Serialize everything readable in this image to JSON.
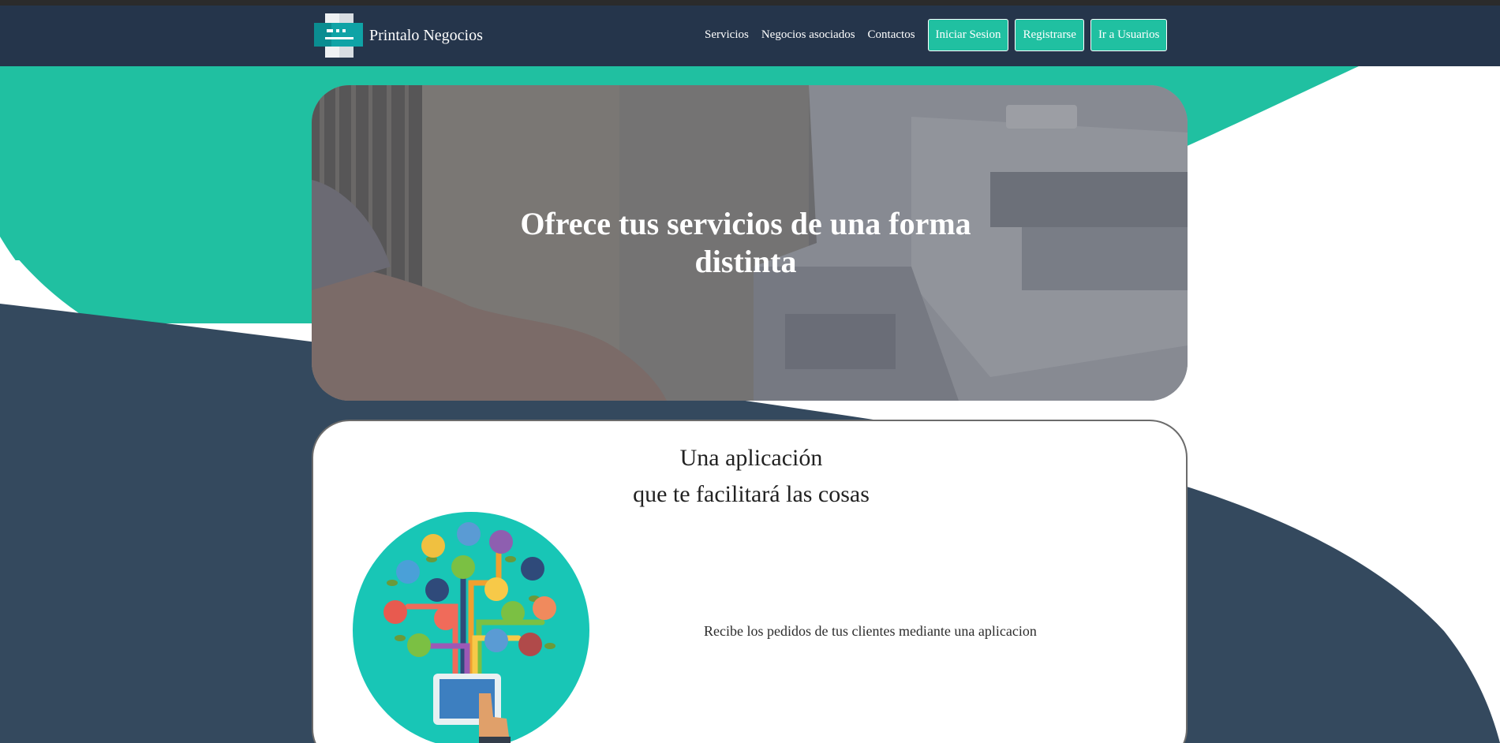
{
  "brand": {
    "name": "Printalo Negocios",
    "logo_icon": "printer-logo-icon"
  },
  "nav": {
    "links": [
      "Servicios",
      "Negocios asociados",
      "Contactos"
    ],
    "buttons": [
      "Iniciar Sesion",
      "Registrarse",
      "Ir a Usuarios"
    ]
  },
  "hero": {
    "title": "Ofrece tus servicios de una forma distinta",
    "image_icon": "printer-photo"
  },
  "card": {
    "title_line1": "Una aplicación",
    "title_line2": "que te facilitará las cosas",
    "text": "Recibe los pedidos de tus clientes mediante una aplicacion",
    "illustration_icon": "app-tree-illustration"
  },
  "colors": {
    "navbar": "#25354b",
    "accent": "#20c0a1",
    "dark_wave": "#34495e",
    "white": "#ffffff"
  }
}
